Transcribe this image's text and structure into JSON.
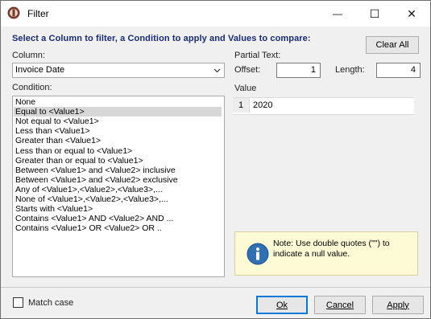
{
  "window": {
    "title": "Filter",
    "minimize_glyph": "—",
    "maximize_glyph": "☐",
    "close_glyph": "✕"
  },
  "heading": "Select a Column to filter, a Condition to apply and Values to compare:",
  "clear_all_label": "Clear All",
  "column": {
    "label": "Column:",
    "value": "Invoice Date"
  },
  "condition": {
    "label": "Condition:",
    "selected_index": 1,
    "items": [
      "None",
      "Equal to <Value1>",
      "Not equal to <Value1>",
      "Less than <Value1>",
      "Greater than <Value1>",
      "Less than or equal to <Value1>",
      "Greater than or equal to <Value1>",
      "Between <Value1> and <Value2> inclusive",
      "Between <Value1> and <Value2> exclusive",
      "Any of <Value1>,<Value2>,<Value3>,...",
      "None of <Value1>,<Value2>,<Value3>,...",
      "Starts with <Value1>",
      "Contains <Value1> AND <Value2> AND ...",
      "Contains <Value1> OR <Value2> OR .."
    ]
  },
  "partial_text": {
    "label": "Partial Text:",
    "offset_label": "Offset:",
    "offset_value": "1",
    "length_label": "Length:",
    "length_value": "4"
  },
  "value_grid": {
    "label": "Value",
    "rows": [
      {
        "index": "1",
        "value": "2020"
      }
    ]
  },
  "note": {
    "icon": "info-icon",
    "text": "Note: Use double quotes (\"\") to indicate a null value."
  },
  "match_case": {
    "label": "Match case",
    "checked": false
  },
  "buttons": {
    "ok": "Ok",
    "cancel": "Cancel",
    "apply": "Apply"
  },
  "colors": {
    "heading": "#1a2a7a",
    "note_bg": "#fdfbd6",
    "info_blue": "#2f6fb3",
    "selection": "#d7d7d7"
  }
}
